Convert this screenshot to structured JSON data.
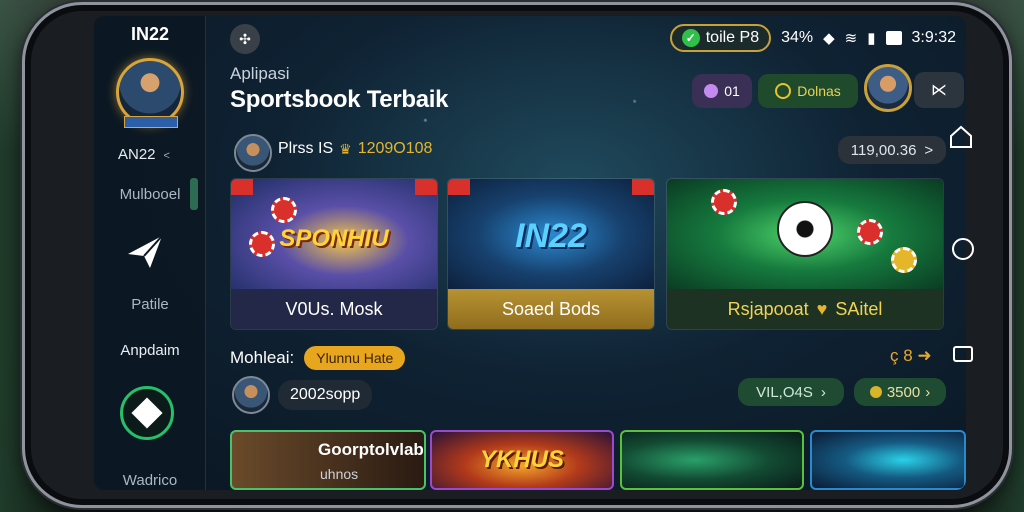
{
  "sidebar": {
    "brand": "IN22",
    "avatar_tag": "",
    "username": "AN22",
    "username_chevron": "<",
    "items": [
      {
        "label": "Mulbooel"
      },
      {
        "label": "Patile"
      },
      {
        "label": "Anpdaim"
      },
      {
        "label": "Wadrico"
      }
    ]
  },
  "header": {
    "home_icon": "circle-logo-icon",
    "subtitle": "Aplipasi",
    "title": "Sportsbook Terbaik"
  },
  "status_bar": {
    "pill_text": "toile P8",
    "signal": "34%",
    "time": "3:9:32"
  },
  "top_pills": {
    "gem_value": "01",
    "coin_label": "Dolnas",
    "share_icon": "share-icon"
  },
  "player_row": {
    "name": "Plrss IS",
    "score": "1209O108",
    "balance": "119,00.36",
    "balance_chevron": ">"
  },
  "game_cards": [
    {
      "art_title": "SPONHIU",
      "label": "V0Us. Mosk"
    },
    {
      "art_title": "IN22",
      "label": "Soaed Bods"
    },
    {
      "art_title": "",
      "label": "Rsjapooat",
      "label_suffix": "SAitel"
    }
  ],
  "section": {
    "label": "Mohleai:",
    "hot_pill": "Ylunnu Hate",
    "right_text": "ç 8",
    "code": "2002sopp",
    "vil_pill": "VIL,O4S",
    "coin_pill": "3500"
  },
  "bottom_cards": [
    {
      "title": "Goorptolvlabil",
      "subtitle": "uhnos"
    },
    {
      "title": "YKHUS"
    },
    {
      "title": ""
    },
    {
      "title": ""
    }
  ],
  "colors": {
    "accent_gold": "#e6b62a",
    "accent_green": "#27c06a",
    "screen_bg": "#0f2233"
  }
}
